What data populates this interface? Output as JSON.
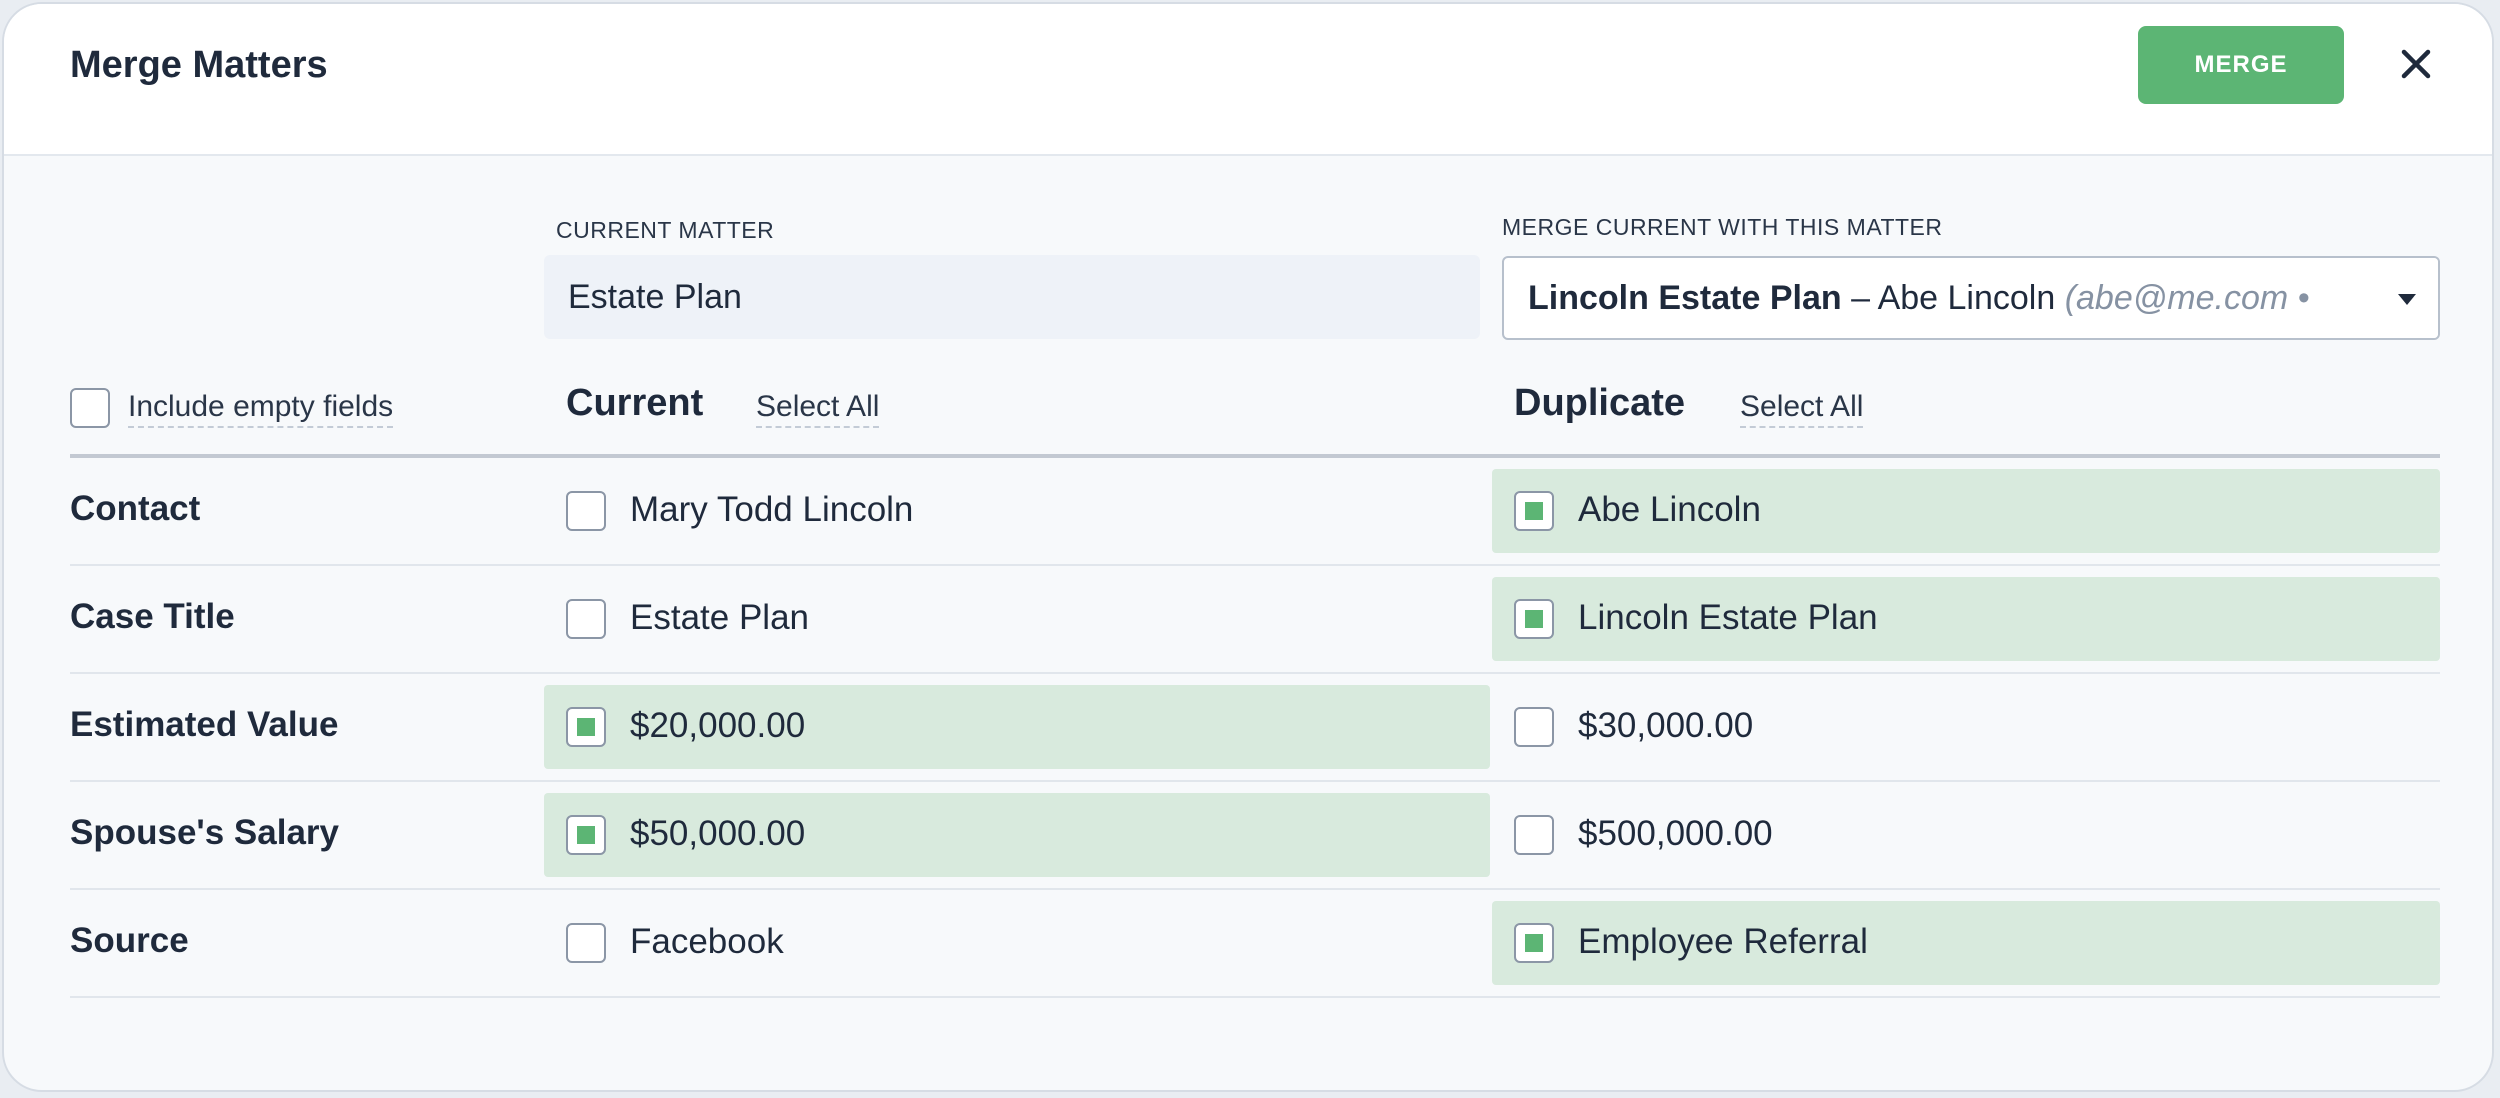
{
  "dialog": {
    "title": "Merge Matters",
    "merge_label": "MERGE",
    "close_symbol": "×"
  },
  "current_matter": {
    "label": "CURRENT MATTER",
    "value": "Estate Plan"
  },
  "merge_with": {
    "label": "MERGE CURRENT WITH THIS MATTER",
    "selected_title": "Lincoln Estate Plan",
    "separator": " – ",
    "selected_contact": "Abe Lincoln",
    "selected_detail": "(abe@me.com •"
  },
  "options": {
    "include_empty_label": "Include empty fields",
    "include_empty_checked": false
  },
  "columns": {
    "current": "Current",
    "duplicate": "Duplicate",
    "select_all": "Select All"
  },
  "rows": [
    {
      "label": "Contact",
      "current": "Mary Todd Lincoln",
      "duplicate": "Abe Lincoln",
      "selected": "duplicate"
    },
    {
      "label": "Case Title",
      "current": "Estate Plan",
      "duplicate": "Lincoln Estate Plan",
      "selected": "duplicate"
    },
    {
      "label": "Estimated Value",
      "current": "$20,000.00",
      "duplicate": "$30,000.00",
      "selected": "current"
    },
    {
      "label": "Spouse's Salary",
      "current": "$50,000.00",
      "duplicate": "$500,000.00",
      "selected": "current"
    },
    {
      "label": "Source",
      "current": "Facebook",
      "duplicate": "Employee Referral",
      "selected": "duplicate"
    }
  ],
  "colors": {
    "accent": "#5cb574",
    "selected_bg": "#d8eadd",
    "text": "#1f2a3c"
  }
}
